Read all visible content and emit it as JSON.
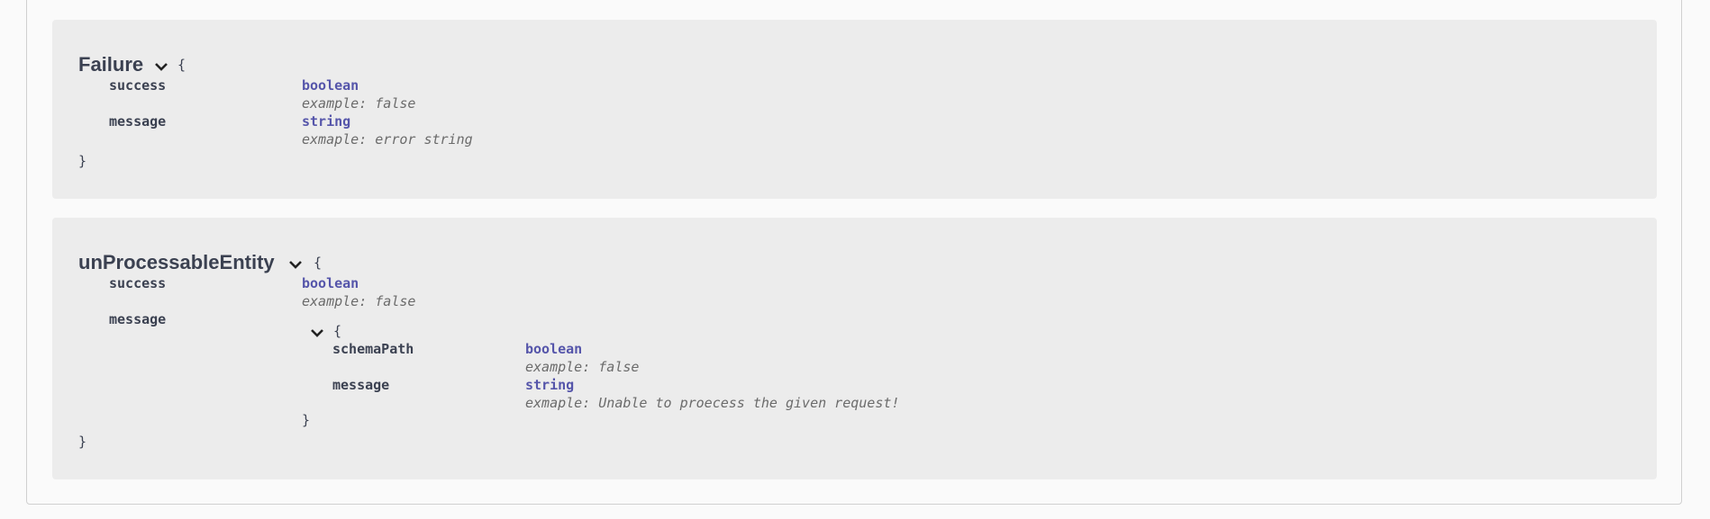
{
  "models": [
    {
      "name": "Failure",
      "open_brace": "{",
      "close_brace": "}",
      "properties": [
        {
          "name": "success",
          "type": "boolean",
          "example": "example: false"
        },
        {
          "name": "message",
          "type": "string",
          "example": "exmaple: error string"
        }
      ]
    },
    {
      "name": "unProcessableEntity",
      "open_brace": "{",
      "close_brace": "}",
      "properties": [
        {
          "name": "success",
          "type": "boolean",
          "example": "example: false"
        },
        {
          "name": "message",
          "nested": {
            "open_brace": "{",
            "close_brace": "}",
            "properties": [
              {
                "name": "schemaPath",
                "type": "boolean",
                "example": "example: false"
              },
              {
                "name": "message",
                "type": "string",
                "example": "exmaple: Unable to proecess the given request!"
              }
            ]
          }
        }
      ]
    }
  ],
  "icons": {
    "expand": "chevron-down-icon"
  }
}
